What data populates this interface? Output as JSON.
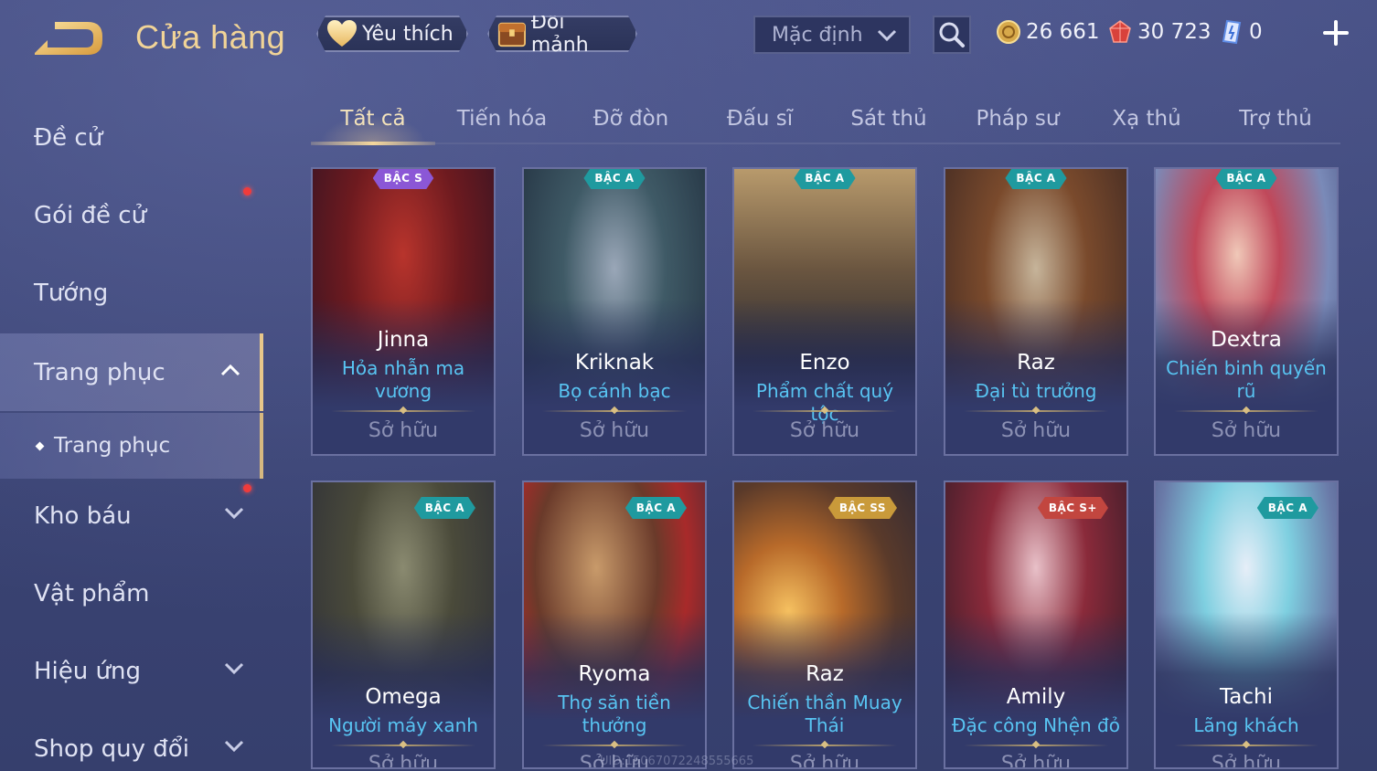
{
  "header": {
    "title": "Cửa hàng",
    "favorites_label": "Yêu thích",
    "shard_exchange_label": "Đổi mảnh",
    "sort_value": "Mặc định",
    "currencies": {
      "gold": "26 661",
      "ruby": "30 723",
      "voucher": "0"
    }
  },
  "sidebar": {
    "items": [
      {
        "label": "Đề cử"
      },
      {
        "label": "Gói đề cử"
      },
      {
        "label": "Tướng"
      },
      {
        "label": "Trang phục"
      },
      {
        "label": "Trang phục"
      },
      {
        "label": "Kho báu"
      },
      {
        "label": "Vật phẩm"
      },
      {
        "label": "Hiệu ứng"
      },
      {
        "label": "Shop quy đổi"
      }
    ]
  },
  "tabs": [
    {
      "label": "Tất cả"
    },
    {
      "label": "Tiến hóa"
    },
    {
      "label": "Đỡ đòn"
    },
    {
      "label": "Đấu sĩ"
    },
    {
      "label": "Sát thủ"
    },
    {
      "label": "Pháp sư"
    },
    {
      "label": "Xạ thủ"
    },
    {
      "label": "Trợ thủ"
    }
  ],
  "cards": [
    {
      "hero": "Jinna",
      "skin": "Hỏa nhẫn ma vương",
      "status": "Sở hữu",
      "tier": "BẬC S",
      "tier_color": "#8b57d6"
    },
    {
      "hero": "Kriknak",
      "skin": "Bọ cánh bạc",
      "status": "Sở hữu",
      "tier": "BẬC A",
      "tier_color": "#1f9a9f"
    },
    {
      "hero": "Enzo",
      "skin": "Phẩm chất quý tộc",
      "status": "Sở hữu",
      "tier": "BẬC A",
      "tier_color": "#1f9a9f"
    },
    {
      "hero": "Raz",
      "skin": "Đại tù trưởng",
      "status": "Sở hữu",
      "tier": "BẬC A",
      "tier_color": "#1f9a9f"
    },
    {
      "hero": "Dextra",
      "skin": "Chiến binh quyến rũ",
      "status": "Sở hữu",
      "tier": "BẬC A",
      "tier_color": "#1f9a9f"
    },
    {
      "hero": "Omega",
      "skin": "Người máy xanh",
      "status": "Sở hữu",
      "tier": "BẬC A",
      "tier_color": "#1f9a9f"
    },
    {
      "hero": "Ryoma",
      "skin": "Thợ săn tiền thưởng",
      "status": "Sở hữu",
      "tier": "BẬC A",
      "tier_color": "#1f9a9f"
    },
    {
      "hero": "Raz",
      "skin": "Chiến thần Muay Thái",
      "status": "Sở hữu",
      "tier": "BẬC SS",
      "tier_color": "#c99a3a"
    },
    {
      "hero": "Amily",
      "skin": "Đặc công Nhện đỏ",
      "status": "Sở hữu",
      "tier": "BẬC S+",
      "tier_color": "#c2463f"
    },
    {
      "hero": "Tachi",
      "skin": "Lãng khách",
      "status": "Sở hữu",
      "tier": "BẬC A",
      "tier_color": "#1f9a9f"
    }
  ],
  "watermark": "UID:15067072248555665"
}
